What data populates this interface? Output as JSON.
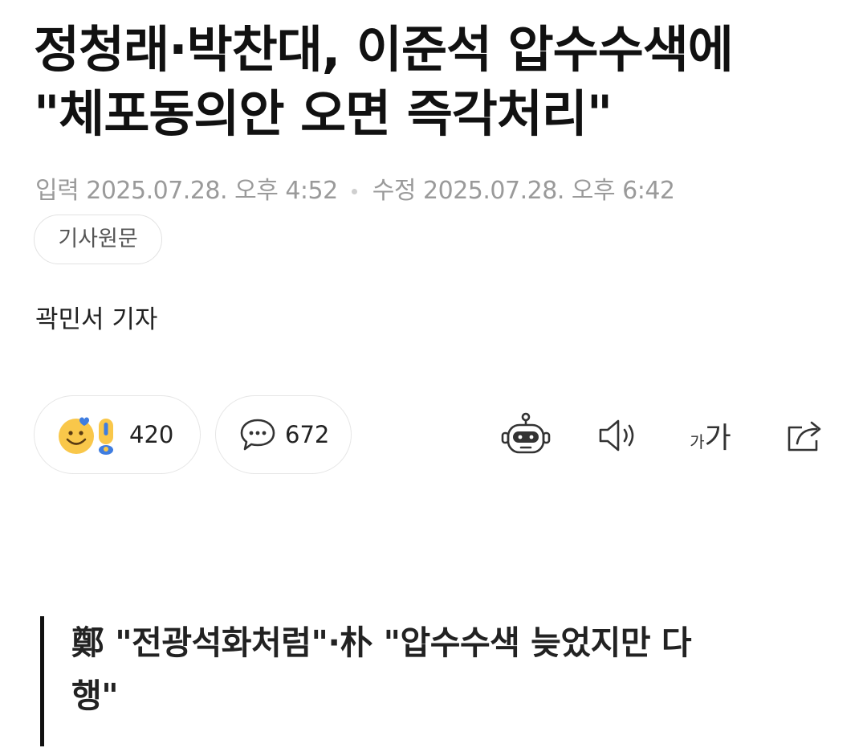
{
  "article": {
    "headline_line1": "정청래·박찬대, 이준석 압수수색에",
    "headline_line2": "\"체포동의안 오면 즉각처리\"",
    "input_label": "입력",
    "input_time": "2025.07.28. 오후 4:52",
    "edit_label": "수정",
    "edit_time": "2025.07.28. 오후 6:42",
    "original_link_label": "기사원문",
    "reporter": "곽민서 기자"
  },
  "actions": {
    "reaction_count": "420",
    "comment_count": "672",
    "font_size_icon_text_small": "가",
    "font_size_icon_text_large": "가"
  },
  "icons": {
    "reaction": "emoji-reaction-icon",
    "comment": "speech-bubble-icon",
    "summary_bot": "robot-icon",
    "tts": "speaker-icon",
    "font_size": "font-size-icon",
    "share": "share-icon"
  },
  "subheadline": {
    "line1": "鄭 \"전광석화처럼\"·朴 \"압수수색 늦었지만 다",
    "line2": "행\""
  },
  "colors": {
    "text_primary": "#111111",
    "text_meta": "#9a9a9a",
    "border": "#e6e6e6",
    "emoji_yellow": "#f9c74a",
    "emoji_blue": "#3f7de0"
  }
}
